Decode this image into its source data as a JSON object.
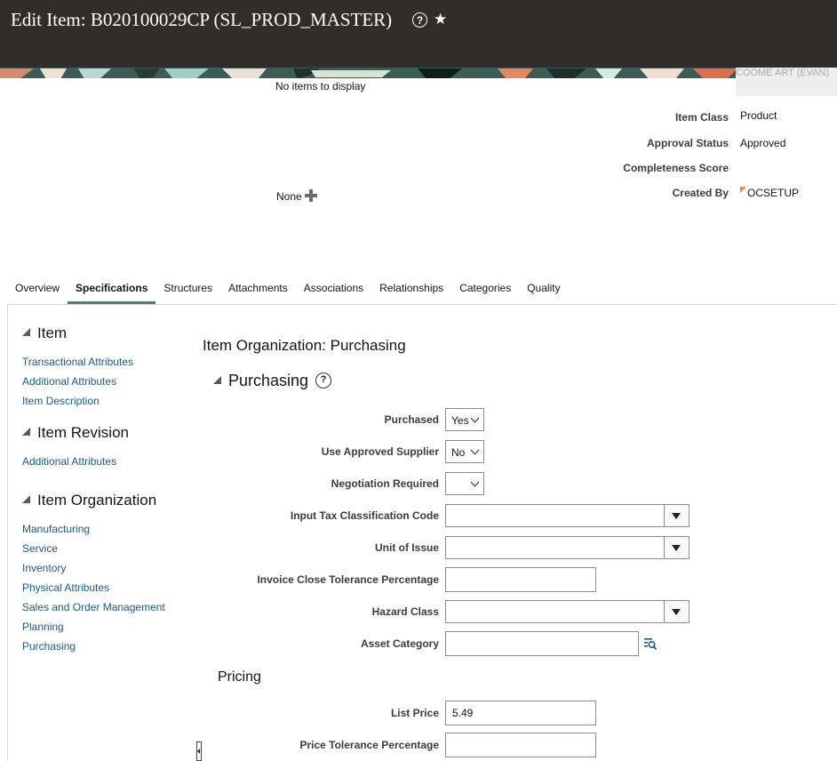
{
  "header": {
    "title": "Edit Item: B020100029CP (SL_PROD_MASTER)",
    "help_icon": "help-circle-icon",
    "favorite_icon": "star-icon",
    "banner_right_text": "COOME ART (EVAN)"
  },
  "overview": {
    "no_items_text": "No items to display",
    "none_text": "None",
    "add_icon": "plus-icon",
    "fields": [
      {
        "label": "Item Class",
        "value": "Product"
      },
      {
        "label": "Approval Status",
        "value": "Approved"
      },
      {
        "label": "Completeness Score",
        "value": ""
      },
      {
        "label": "Created By",
        "value": "OCSETUP"
      }
    ]
  },
  "tabs": [
    {
      "label": "Overview"
    },
    {
      "label": "Specifications",
      "active": true
    },
    {
      "label": "Structures"
    },
    {
      "label": "Attachments"
    },
    {
      "label": "Associations"
    },
    {
      "label": "Relationships"
    },
    {
      "label": "Categories"
    },
    {
      "label": "Quality"
    }
  ],
  "nav": {
    "sections": [
      {
        "title": "Item",
        "links": [
          "Transactional Attributes",
          "Additional Attributes",
          "Item Description"
        ]
      },
      {
        "title": "Item Revision",
        "links": [
          "Additional Attributes"
        ]
      },
      {
        "title": "Item Organization",
        "links": [
          "Manufacturing",
          "Service",
          "Inventory",
          "Physical Attributes",
          "Sales and Order Management",
          "Planning",
          "Purchasing"
        ]
      }
    ]
  },
  "main": {
    "page_title": "Item Organization: Purchasing",
    "section_title": "Purchasing",
    "fields": {
      "purchased": {
        "label": "Purchased",
        "value": "Yes"
      },
      "use_approved_supplier": {
        "label": "Use Approved Supplier",
        "value": "No"
      },
      "negotiation_required": {
        "label": "Negotiation Required",
        "value": ""
      },
      "input_tax": {
        "label": "Input Tax Classification Code",
        "value": ""
      },
      "unit_of_issue": {
        "label": "Unit of Issue",
        "value": ""
      },
      "invoice_close": {
        "label": "Invoice Close Tolerance Percentage",
        "value": ""
      },
      "hazard_class": {
        "label": "Hazard Class",
        "value": ""
      },
      "asset_category": {
        "label": "Asset Category",
        "value": ""
      }
    },
    "pricing_title": "Pricing",
    "pricing_fields": {
      "list_price": {
        "label": "List Price",
        "value": "5.49"
      },
      "price_tolerance": {
        "label": "Price Tolerance Percentage",
        "value": ""
      }
    }
  }
}
